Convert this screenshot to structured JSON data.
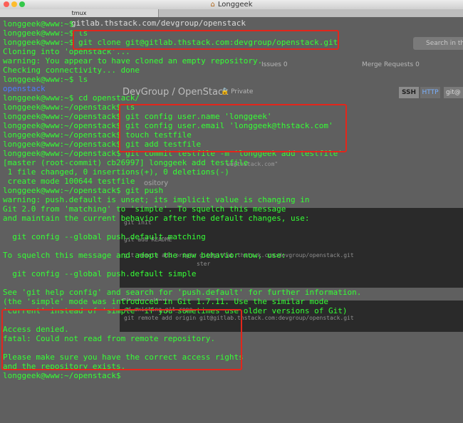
{
  "window": {
    "title": "Longgeek",
    "tab": "tmux"
  },
  "background_page": {
    "url": "gitlab.thstack.com/devgroup/openstack",
    "search_placeholder": "Search in thi",
    "issues": "Issues  0",
    "merge_requests": "Merge Requests  0",
    "project_title": "DevGroup / OpenStack",
    "private_label": "Private",
    "ssh": "SSH",
    "http": "HTTP",
    "git": "git@",
    "email_hint": "uu@thstack.com\"",
    "create_repo": "ository",
    "code_lines": [
      "git init",
      "git add README",
      "git remote add origin git@gitlab.thstack.com:devgroup/openstack.git",
      "ster"
    ],
    "existing_heading": "Git repository",
    "existing_lines": [
      "cd existing_git_repo",
      "git remote add origin git@gitlab.thstack.com:devgroup/openstack.git"
    ]
  },
  "terminal": {
    "lines": [
      {
        "text": "longgeek@www:~$ ",
        "color": "green"
      },
      {
        "text": "longgeek@www:~$ ls",
        "color": "green"
      },
      {
        "text": "longgeek@www:~$ git clone git@gitlab.thstack.com:devgroup/openstack.git",
        "color": "green"
      },
      {
        "text": "Cloning into 'openstack'...",
        "color": "green"
      },
      {
        "text": "warning: You appear to have cloned an empty repository.",
        "color": "green"
      },
      {
        "text": "Checking connectivity... done",
        "color": "green"
      },
      {
        "text": "longgeek@www:~$ ls",
        "color": "green"
      },
      {
        "text": "openstack",
        "color": "blue"
      },
      {
        "text": "longgeek@www:~$ cd openstack/",
        "color": "green"
      },
      {
        "text": "longgeek@www:~/openstack$ ls",
        "color": "green"
      },
      {
        "text": "longgeek@www:~/openstack$ git config user.name 'longgeek'",
        "color": "green"
      },
      {
        "text": "longgeek@www:~/openstack$ git config user.email 'longgeek@thstack.com'",
        "color": "green"
      },
      {
        "text": "longgeek@www:~/openstack$ touch testfile",
        "color": "green"
      },
      {
        "text": "longgeek@www:~/openstack$ git add testfile",
        "color": "green"
      },
      {
        "text": "longgeek@www:~/openstack$ git commit testfile -m 'longgeek add testfile'",
        "color": "green"
      },
      {
        "text": "[master (root-commit) cb26997] longgeek add testfile",
        "color": "green"
      },
      {
        "text": " 1 file changed, 0 insertions(+), 0 deletions(-)",
        "color": "green"
      },
      {
        "text": " create mode 100644 testfile",
        "color": "green"
      },
      {
        "text": "longgeek@www:~/openstack$ git push",
        "color": "green"
      },
      {
        "text": "warning: push.default is unset; its implicit value is changing in",
        "color": "green"
      },
      {
        "text": "Git 2.0 from 'matching' to 'simple'. To squelch this message",
        "color": "green"
      },
      {
        "text": "and maintain the current behavior after the default changes, use:",
        "color": "green"
      },
      {
        "text": "",
        "color": "green"
      },
      {
        "text": "  git config --global push.default matching",
        "color": "green"
      },
      {
        "text": "",
        "color": "green"
      },
      {
        "text": "To squelch this message and adopt the new behavior now, use:",
        "color": "green"
      },
      {
        "text": "",
        "color": "green"
      },
      {
        "text": "  git config --global push.default simple",
        "color": "green"
      },
      {
        "text": "",
        "color": "green"
      },
      {
        "text": "See 'git help config' and search for 'push.default' for further information.",
        "color": "green"
      },
      {
        "text": "(the 'simple' mode was introduced in Git 1.7.11. Use the similar mode",
        "color": "green"
      },
      {
        "text": "'current' instead of 'simple' if you sometimes use older versions of Git)",
        "color": "green"
      },
      {
        "text": "",
        "color": "green"
      },
      {
        "text": "Access denied.",
        "color": "green"
      },
      {
        "text": "fatal: Could not read from remote repository.",
        "color": "green"
      },
      {
        "text": "",
        "color": "green"
      },
      {
        "text": "Please make sure you have the correct access rights",
        "color": "green"
      },
      {
        "text": "and the repository exists.",
        "color": "green"
      },
      {
        "text": "longgeek@www:~/openstack$ ",
        "color": "green"
      }
    ]
  },
  "colors": {
    "green": "#35ff35",
    "blue": "#4b7dff",
    "highlight": "#e3261b"
  }
}
